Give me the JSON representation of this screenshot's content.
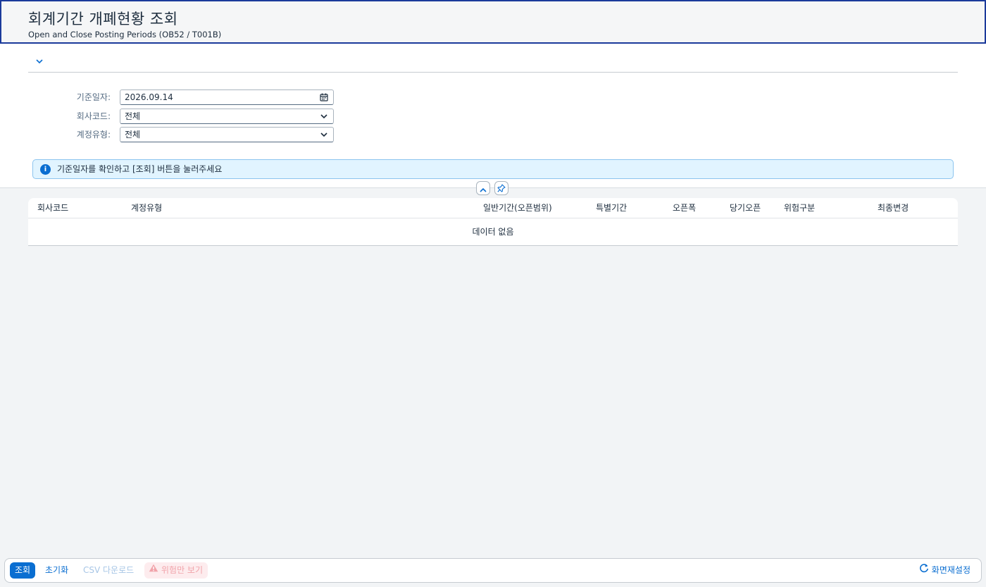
{
  "header": {
    "title": "회계기간 개폐현황 조회",
    "subtitle": "Open and Close Posting Periods (OB52 / T001B)"
  },
  "filters": {
    "date_label": "기준일자:",
    "date_value": "2026.09.14",
    "company_label": "회사코드:",
    "company_value": "전체",
    "account_type_label": "계정유형:",
    "account_type_value": "전체"
  },
  "info_message": "기준일자를 확인하고 [조회] 버튼을 눌러주세요",
  "table": {
    "columns": [
      "회사코드",
      "계정유형",
      "일반기간(오픈범위)",
      "특별기간",
      "오픈폭",
      "당기오픈",
      "위험구분",
      "최종변경"
    ],
    "empty_text": "데이터 없음"
  },
  "footer": {
    "search_label": "조회",
    "reset_label": "초기화",
    "csv_label": "CSV 다운로드",
    "risk_only_label": "위험만 보기",
    "screen_reset_label": "화면재설정"
  },
  "colors": {
    "accent": "#0a6ed1",
    "header_border": "#1b3a9b",
    "info_bg": "#e1f4ff",
    "risk_bg": "#fdecee",
    "background": "#f2f4f6"
  },
  "icons": {
    "expand": "chevron-down-icon",
    "date": "calendar-icon",
    "select": "chevron-down-icon",
    "info": "info-icon",
    "collapse": "chevron-up-icon",
    "pin": "pin-icon",
    "warning": "warning-icon",
    "refresh": "refresh-icon"
  }
}
